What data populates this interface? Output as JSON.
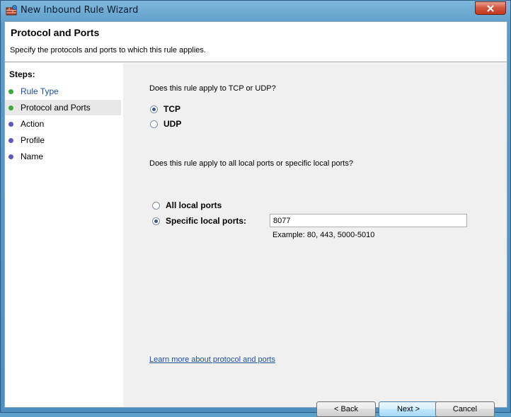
{
  "window": {
    "title": "New Inbound Rule Wizard"
  },
  "header": {
    "title": "Protocol and Ports",
    "subtitle": "Specify the protocols and ports to which this rule applies."
  },
  "steps": {
    "title": "Steps:",
    "items": [
      {
        "label": "Rule Type",
        "state": "link",
        "dot_color": "#3fa83f"
      },
      {
        "label": "Protocol and Ports",
        "state": "active",
        "dot_color": "#3fa83f"
      },
      {
        "label": "Action",
        "state": "pending",
        "dot_color": "#5a5ab8"
      },
      {
        "label": "Profile",
        "state": "pending",
        "dot_color": "#5a5ab8"
      },
      {
        "label": "Name",
        "state": "pending",
        "dot_color": "#5a5ab8"
      }
    ]
  },
  "protocol": {
    "question": "Does this rule apply to TCP or UDP?",
    "options": [
      {
        "label": "TCP",
        "selected": true
      },
      {
        "label": "UDP",
        "selected": false
      }
    ]
  },
  "ports": {
    "question": "Does this rule apply to all local ports or specific local ports?",
    "options": [
      {
        "label": "All local ports",
        "selected": false
      },
      {
        "label": "Specific local ports:",
        "selected": true
      }
    ],
    "value": "8077",
    "example": "Example: 80, 443, 5000-5010"
  },
  "learn_more": "Learn more about protocol and ports",
  "buttons": {
    "back": "< Back",
    "next": "Next >",
    "cancel": "Cancel"
  }
}
